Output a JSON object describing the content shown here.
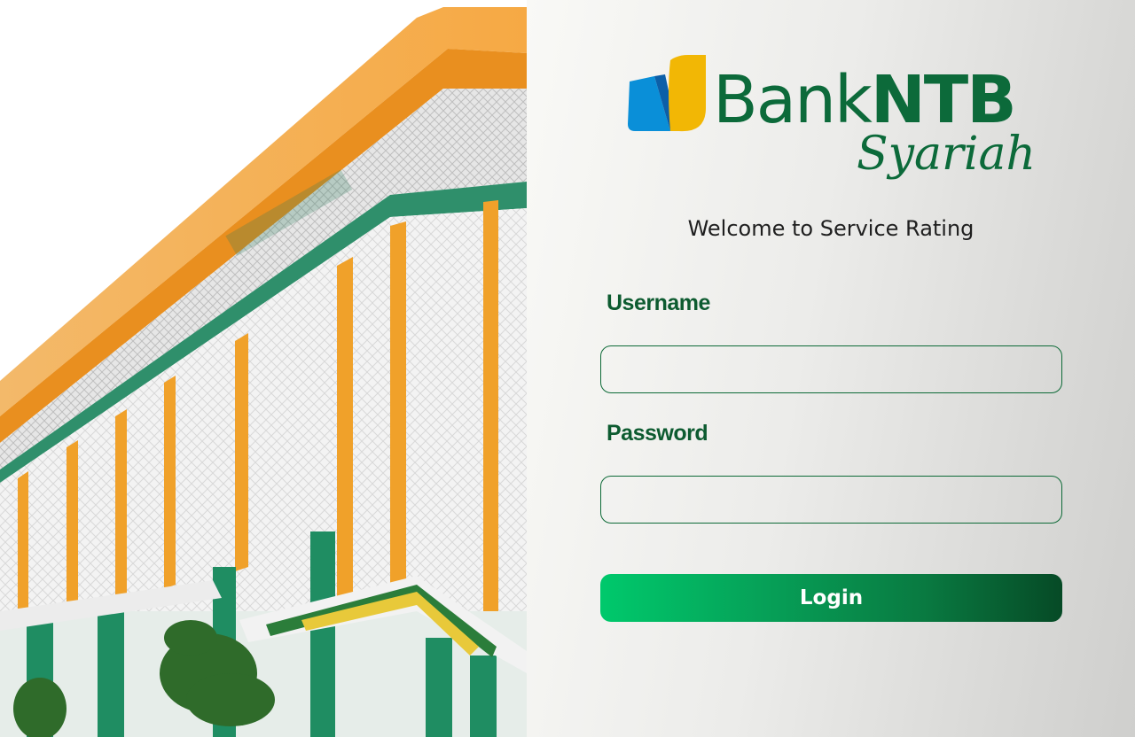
{
  "brand": {
    "name_part1": "Bank",
    "name_part2": "NTB",
    "name_part3": "Syariah"
  },
  "welcome_text": "Welcome to Service Rating",
  "form": {
    "username_label": "Username",
    "username_value": "",
    "password_label": "Password",
    "password_value": "",
    "login_label": "Login"
  },
  "colors": {
    "brand_green": "#0c6a3a",
    "button_gradient_start": "#00c96c",
    "button_gradient_end": "#064a26",
    "logo_blue": "#0a8fd8",
    "logo_yellow": "#f2b705"
  }
}
